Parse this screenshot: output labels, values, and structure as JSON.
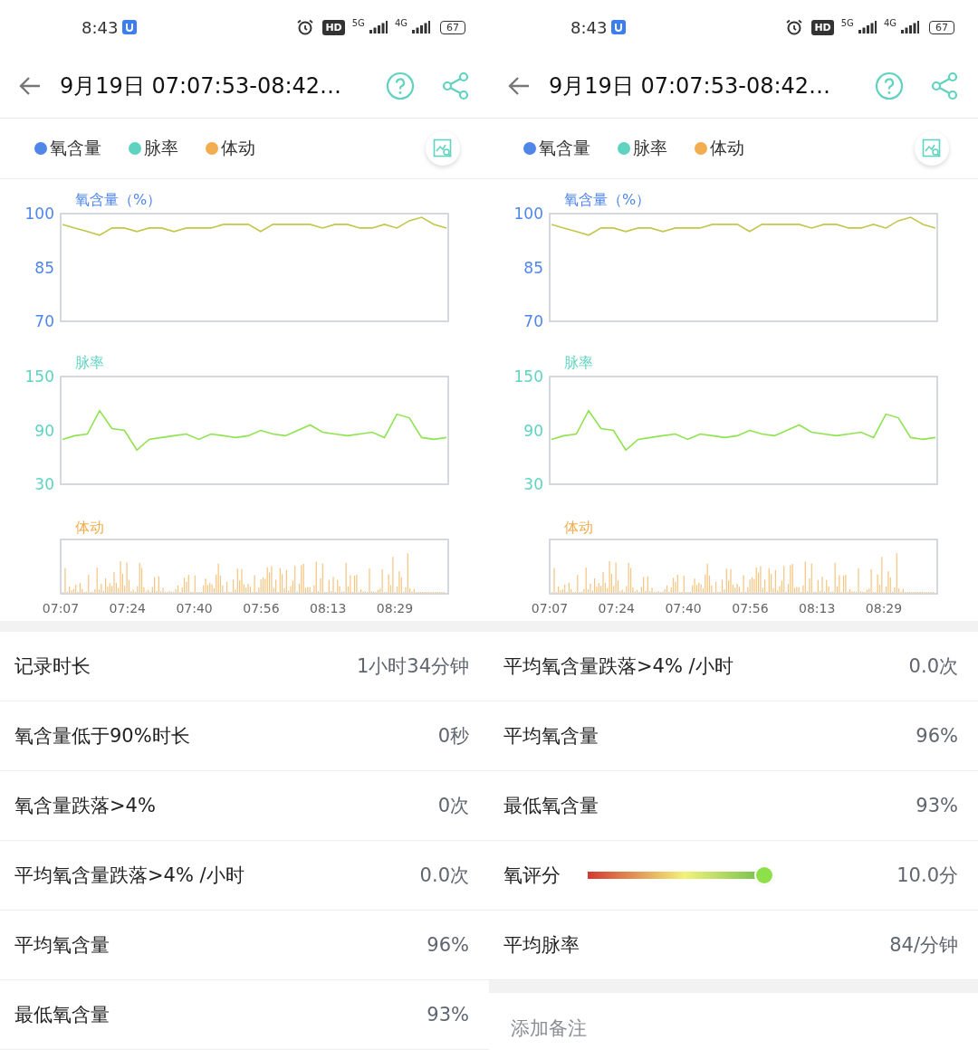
{
  "screens": [
    {
      "status_bar": {
        "time": "8:43",
        "hd": "HD",
        "networks": [
          "5G",
          "4G"
        ],
        "battery": "67"
      },
      "header": {
        "title": "9月19日 07:07:53-08:42…"
      },
      "legend": [
        {
          "label": "氧含量",
          "color": "#4f86e8"
        },
        {
          "label": "脉率",
          "color": "#5fd3c0"
        },
        {
          "label": "体动",
          "color": "#f2ad4e"
        }
      ],
      "charts": [
        {
          "title": "氧含量（%）",
          "color": "#4f86e8",
          "chart_data": {
            "type": "line",
            "ylim": [
              70,
              100
            ],
            "yticks": [
              100,
              85,
              70
            ],
            "categories": [
              null,
              null,
              null,
              null,
              null,
              null,
              null,
              null,
              null,
              null,
              null,
              null,
              null,
              null,
              null,
              null,
              null,
              null,
              null,
              null,
              null,
              null,
              null,
              null,
              null,
              null,
              null,
              null,
              null,
              null,
              null,
              null
            ],
            "series": [
              {
                "color": "#c3c64a",
                "values": [
                  97,
                  96,
                  95,
                  94,
                  96,
                  96,
                  95,
                  96,
                  96,
                  95,
                  96,
                  96,
                  96,
                  97,
                  97,
                  97,
                  95,
                  97,
                  97,
                  97,
                  97,
                  96,
                  97,
                  97,
                  96,
                  96,
                  97,
                  96,
                  98,
                  99,
                  97,
                  96
                ]
              }
            ]
          }
        },
        {
          "title": "脉率",
          "color": "#5fd3c0",
          "chart_data": {
            "type": "line",
            "ylim": [
              30,
              150
            ],
            "yticks": [
              150,
              90,
              30
            ],
            "categories": [
              null,
              null,
              null,
              null,
              null,
              null,
              null,
              null,
              null,
              null,
              null,
              null,
              null,
              null,
              null,
              null,
              null,
              null,
              null,
              null,
              null,
              null,
              null,
              null,
              null,
              null,
              null,
              null,
              null,
              null,
              null,
              null
            ],
            "series": [
              {
                "color": "#8fe34f",
                "values": [
                  80,
                  84,
                  86,
                  112,
                  92,
                  90,
                  68,
                  80,
                  82,
                  84,
                  86,
                  80,
                  86,
                  84,
                  82,
                  84,
                  90,
                  86,
                  84,
                  90,
                  96,
                  88,
                  86,
                  84,
                  86,
                  88,
                  82,
                  108,
                  104,
                  82,
                  80,
                  82
                ]
              }
            ]
          }
        }
      ],
      "movement": {
        "title": "体动",
        "time_axis": [
          "07:07",
          "07:24",
          "07:40",
          "07:56",
          "08:13",
          "08:29"
        ]
      },
      "stats": [
        {
          "kind": "text",
          "label": "记录时长",
          "value": "1小时34分钟"
        },
        {
          "kind": "text",
          "label": "氧含量低于90%时长",
          "value": "0秒"
        },
        {
          "kind": "text",
          "label": "氧含量跌落>4%",
          "value": "0次"
        },
        {
          "kind": "text",
          "label": "平均氧含量跌落>4% /小时",
          "value": "0.0次"
        },
        {
          "kind": "text",
          "label": "平均氧含量",
          "value": "96%"
        },
        {
          "kind": "text",
          "label": "最低氧含量",
          "value": "93%"
        }
      ]
    },
    {
      "status_bar": {
        "time": "8:43",
        "hd": "HD",
        "networks": [
          "5G",
          "4G"
        ],
        "battery": "67"
      },
      "header": {
        "title": "9月19日 07:07:53-08:42…"
      },
      "legend": [
        {
          "label": "氧含量",
          "color": "#4f86e8"
        },
        {
          "label": "脉率",
          "color": "#5fd3c0"
        },
        {
          "label": "体动",
          "color": "#f2ad4e"
        }
      ],
      "charts": [
        {
          "title": "氧含量（%）",
          "color": "#4f86e8",
          "chart_data": {
            "type": "line",
            "ylim": [
              70,
              100
            ],
            "yticks": [
              100,
              85,
              70
            ],
            "categories": [
              null,
              null,
              null,
              null,
              null,
              null,
              null,
              null,
              null,
              null,
              null,
              null,
              null,
              null,
              null,
              null,
              null,
              null,
              null,
              null,
              null,
              null,
              null,
              null,
              null,
              null,
              null,
              null,
              null,
              null,
              null,
              null
            ],
            "series": [
              {
                "color": "#c3c64a",
                "values": [
                  97,
                  96,
                  95,
                  94,
                  96,
                  96,
                  95,
                  96,
                  96,
                  95,
                  96,
                  96,
                  96,
                  97,
                  97,
                  97,
                  95,
                  97,
                  97,
                  97,
                  97,
                  96,
                  97,
                  97,
                  96,
                  96,
                  97,
                  96,
                  98,
                  99,
                  97,
                  96
                ]
              }
            ]
          }
        },
        {
          "title": "脉率",
          "color": "#5fd3c0",
          "chart_data": {
            "type": "line",
            "ylim": [
              30,
              150
            ],
            "yticks": [
              150,
              90,
              30
            ],
            "categories": [
              null,
              null,
              null,
              null,
              null,
              null,
              null,
              null,
              null,
              null,
              null,
              null,
              null,
              null,
              null,
              null,
              null,
              null,
              null,
              null,
              null,
              null,
              null,
              null,
              null,
              null,
              null,
              null,
              null,
              null,
              null,
              null
            ],
            "series": [
              {
                "color": "#8fe34f",
                "values": [
                  80,
                  84,
                  86,
                  112,
                  92,
                  90,
                  68,
                  80,
                  82,
                  84,
                  86,
                  80,
                  86,
                  84,
                  82,
                  84,
                  90,
                  86,
                  84,
                  90,
                  96,
                  88,
                  86,
                  84,
                  86,
                  88,
                  82,
                  108,
                  104,
                  82,
                  80,
                  82
                ]
              }
            ]
          }
        }
      ],
      "movement": {
        "title": "体动",
        "time_axis": [
          "07:07",
          "07:24",
          "07:40",
          "07:56",
          "08:13",
          "08:29"
        ]
      },
      "stats": [
        {
          "kind": "text",
          "label": "平均氧含量跌落>4% /小时",
          "value": "0.0次"
        },
        {
          "kind": "text",
          "label": "平均氧含量",
          "value": "96%"
        },
        {
          "kind": "text",
          "label": "最低氧含量",
          "value": "93%"
        },
        {
          "kind": "score",
          "label": "氧评分",
          "level": 1.0,
          "value": "10.0分"
        },
        {
          "kind": "text",
          "label": "平均脉率",
          "value": "84/分钟"
        }
      ],
      "note": {
        "placeholder": "添加备注"
      }
    }
  ]
}
